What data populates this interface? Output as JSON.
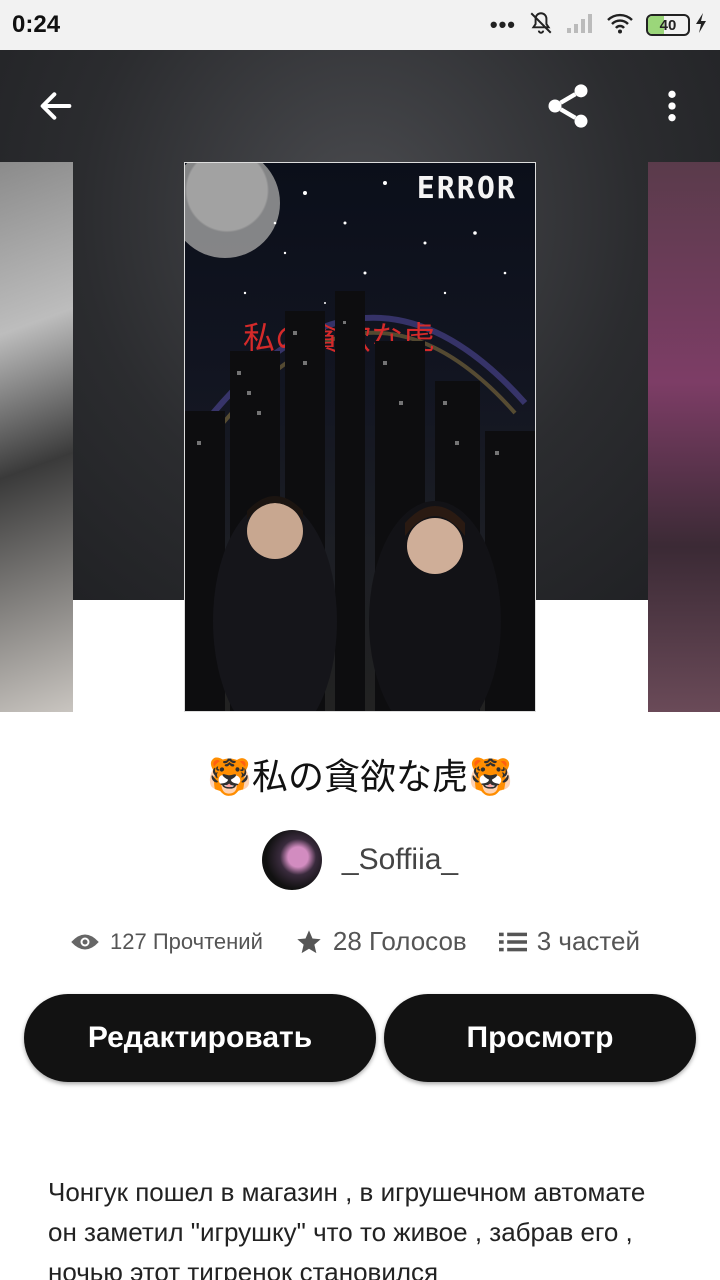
{
  "status_bar": {
    "time": "0:24",
    "battery": "40",
    "battery_level": 0.4,
    "icons": [
      "more-dots-icon",
      "mute-icon",
      "signal-icon",
      "wifi-icon",
      "battery-icon",
      "charging-icon"
    ]
  },
  "toolbar": {
    "icons": [
      "back-arrow-icon",
      "share-icon",
      "more-vertical-icon"
    ]
  },
  "cover": {
    "badge_text": "ERROR",
    "jp_title": "私の貪欲な虎"
  },
  "story": {
    "title": "🐯私の貪欲な虎🐯",
    "author": "_Soffiia_"
  },
  "stats": {
    "reads": "127 Прочтений",
    "votes": "28 Голосов",
    "parts": "3 частей"
  },
  "actions": {
    "edit_label": "Редактировать",
    "view_label": "Просмотр"
  },
  "description": "Чонгук пошел в магазин , в игрушечном автомате он заметил \"игрушку\" что то живое , забрав его , ночью этот тигренок становился",
  "colors": {
    "button_bg": "#121212",
    "hero_bg": "#2b2c2f",
    "cover_title": "#d52a2a"
  }
}
